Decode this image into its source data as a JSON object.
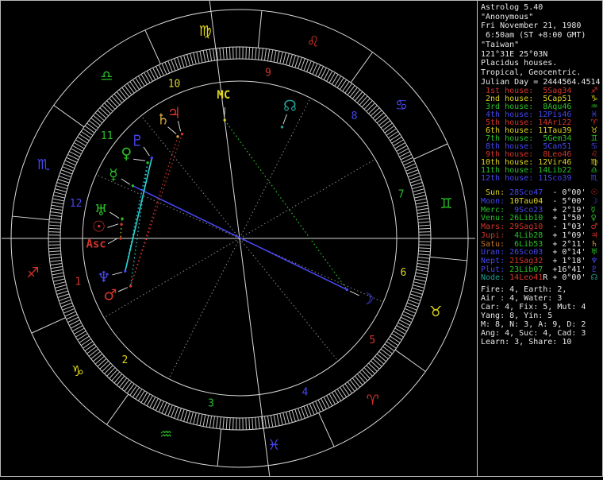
{
  "app_title": "Astrolog 5.40",
  "colors": {
    "white": "#e8e8e8",
    "red": "#d2352a",
    "yellow": "#ddd41f",
    "green": "#28c128",
    "blue": "#4646ee",
    "cyan": "#2ad2d2",
    "teal": "#1f9e93",
    "orange": "#c4752b",
    "saturn_glyph": "#cfa13a",
    "gray": "#8a8a8a",
    "line": "#d8d8d8",
    "tick": "#c4c4c4"
  },
  "panel": {
    "header_lines": [
      "Astrolog 5.40",
      "\"Anonymous\"",
      "Fri November 21, 1980",
      " 6:50am (ST +8:00 GMT)",
      "\"Taiwan\"",
      "121°31E 25°03N",
      "Placidus houses.",
      "Tropical, Geocentric.",
      "Julian Day = 2444564.4514"
    ],
    "houses": [
      {
        "ord": "1st",
        "cusp": "5Sag34",
        "color": "red",
        "glyph": "♐"
      },
      {
        "ord": "2nd",
        "cusp": "5Cap51",
        "color": "yellow",
        "glyph": "♑"
      },
      {
        "ord": "3rd",
        "cusp": "8Aqu46",
        "color": "green",
        "glyph": "♒"
      },
      {
        "ord": "4th",
        "cusp": "12Pis46",
        "color": "blue",
        "glyph": "♓"
      },
      {
        "ord": "5th",
        "cusp": "14Ari22",
        "color": "red",
        "glyph": "♈"
      },
      {
        "ord": "6th",
        "cusp": "11Tau39",
        "color": "yellow",
        "glyph": "♉"
      },
      {
        "ord": "7th",
        "cusp": "5Gem34",
        "color": "green",
        "glyph": "♊"
      },
      {
        "ord": "8th",
        "cusp": "5Can51",
        "color": "blue",
        "glyph": "♋"
      },
      {
        "ord": "9th",
        "cusp": "8Leo46",
        "color": "red",
        "glyph": "♌"
      },
      {
        "ord": "10th",
        "cusp": "12Vir46",
        "color": "yellow",
        "glyph": "♍"
      },
      {
        "ord": "11th",
        "cusp": "14Lib22",
        "color": "green",
        "glyph": "♎"
      },
      {
        "ord": "12th",
        "cusp": "11Sco39",
        "color": "blue",
        "glyph": "♏"
      }
    ],
    "planets": [
      {
        "name": "Sun",
        "pos": "28Sco47",
        "retro": false,
        "lat": "- 0°00'",
        "label_color": "yellow",
        "pos_color": "blue",
        "glyph": "☉",
        "glyph_color": "red",
        "lon": 238.783,
        "nudge": -2.1
      },
      {
        "name": "Moon",
        "pos": "10Tau04",
        "retro": false,
        "lat": "- 5°00'",
        "label_color": "blue",
        "pos_color": "yellow",
        "glyph": "☽",
        "glyph_color": "blue",
        "lon": 40.067,
        "nudge": 0
      },
      {
        "name": "Merc",
        "pos": "9Sco23",
        "retro": false,
        "lat": "+ 2°19'",
        "label_color": "green",
        "pos_color": "blue",
        "glyph": "☿",
        "glyph_color": "green",
        "lon": 219.383,
        "nudge": 0.5
      },
      {
        "name": "Venu",
        "pos": "26Lib10",
        "retro": false,
        "lat": "+ 1°50'",
        "label_color": "green",
        "pos_color": "green",
        "glyph": "♀",
        "glyph_color": "green",
        "lon": 206.167,
        "nudge": -2.7
      },
      {
        "name": "Mars",
        "pos": "29Sag10",
        "retro": false,
        "lat": "- 1°03'",
        "label_color": "red",
        "pos_color": "red",
        "glyph": "♂",
        "glyph_color": "red",
        "lon": 269.167,
        "nudge": 0
      },
      {
        "name": "Jupi",
        "pos": "4Lib28",
        "retro": false,
        "lat": "+ 1°09'",
        "label_color": "red",
        "pos_color": "green",
        "glyph": "♃",
        "glyph_color": "red",
        "lon": 184.467,
        "nudge": 1.2
      },
      {
        "name": "Satu",
        "pos": "6Lib53",
        "retro": false,
        "lat": "+ 2°11'",
        "label_color": "orange",
        "pos_color": "green",
        "glyph": "♄",
        "glyph_color": "saturn_glyph",
        "lon": 186.883,
        "nudge": -1.5
      },
      {
        "name": "Uran",
        "pos": "26Sco03",
        "retro": false,
        "lat": "+ 0°14'",
        "label_color": "blue",
        "pos_color": "blue",
        "glyph": "♅",
        "glyph_color": "green",
        "lon": 236.05,
        "nudge": 1.9
      },
      {
        "name": "Nept",
        "pos": "21Sag32",
        "retro": false,
        "lat": "+ 1°18'",
        "label_color": "blue",
        "pos_color": "red",
        "glyph": "♆",
        "glyph_color": "blue",
        "lon": 261.533,
        "nudge": 0
      },
      {
        "name": "Plut",
        "pos": "23Lib07",
        "retro": false,
        "lat": "+16°41'",
        "label_color": "blue",
        "pos_color": "green",
        "glyph": "♇",
        "glyph_color": "blue",
        "lon": 203.117,
        "nudge": 1.1
      },
      {
        "name": "Node",
        "pos": "14Leo41",
        "retro": true,
        "lat": "+ 0°00'",
        "label_color": "teal",
        "pos_color": "red",
        "glyph": "☊",
        "glyph_color": "teal",
        "lon": 134.683,
        "nudge": 0
      }
    ],
    "stats_lines": [
      "Fire: 4, Earth: 2,",
      "Air : 4, Water: 3",
      "Car: 4, Fix: 5, Mut: 4",
      "Yang: 8, Yin: 5",
      "M: 8, N: 3, A: 9, D: 2",
      "Ang: 4, Suc: 4, Cad: 3",
      "Learn: 3, Share: 10"
    ]
  },
  "wheel": {
    "asc_lon": 245.567,
    "cusps": [
      245.567,
      275.85,
      308.767,
      342.767,
      14.367,
      41.65,
      65.567,
      95.85,
      128.767,
      162.767,
      194.367,
      221.65
    ],
    "house_number_colors": [
      "red",
      "yellow",
      "green",
      "blue",
      "red",
      "yellow",
      "green",
      "blue",
      "red",
      "yellow",
      "green",
      "blue"
    ],
    "signs": [
      {
        "name": "Aries",
        "glyph": "♈",
        "color": "red"
      },
      {
        "name": "Taurus",
        "glyph": "♉",
        "color": "yellow"
      },
      {
        "name": "Gemini",
        "glyph": "♊",
        "color": "green"
      },
      {
        "name": "Cancer",
        "glyph": "♋",
        "color": "blue"
      },
      {
        "name": "Leo",
        "glyph": "♌",
        "color": "red"
      },
      {
        "name": "Virgo",
        "glyph": "♍",
        "color": "yellow"
      },
      {
        "name": "Libra",
        "glyph": "♎",
        "color": "green"
      },
      {
        "name": "Scorpio",
        "glyph": "♏",
        "color": "blue"
      },
      {
        "name": "Sagittarius",
        "glyph": "♐",
        "color": "red"
      },
      {
        "name": "Capricorn",
        "glyph": "♑",
        "color": "yellow"
      },
      {
        "name": "Aquarius",
        "glyph": "♒",
        "color": "green"
      },
      {
        "name": "Pisces",
        "glyph": "♓",
        "color": "blue"
      }
    ],
    "axes": [
      {
        "label": "Asc",
        "color": "red",
        "lon": 245.567,
        "nudge": -2.3
      },
      {
        "label": "MC",
        "color": "yellow",
        "lon": 162.767,
        "nudge": 0.8
      }
    ],
    "aspects": [
      {
        "a": "Merc",
        "b": "Moon",
        "color": "blue",
        "solid": true
      },
      {
        "a": "MC",
        "b": "Moon",
        "color": "green",
        "solid": false
      },
      {
        "a": "Plut",
        "b": "Nept",
        "color": "cyan",
        "solid": true
      },
      {
        "a": "Venu",
        "b": "Nept",
        "color": "cyan",
        "solid": false
      },
      {
        "a": "Venu",
        "b": "Mars",
        "color": "cyan",
        "solid": false
      },
      {
        "a": "Jupi",
        "b": "Mars",
        "color": "red",
        "solid": false
      },
      {
        "a": "Satu",
        "b": "Mars",
        "color": "red",
        "solid": false
      },
      {
        "a": "Sun",
        "b": "Uran",
        "color": "yellow",
        "solid": false
      },
      {
        "a": "Sun",
        "b": "Asc",
        "color": "yellow",
        "solid": false
      }
    ]
  }
}
